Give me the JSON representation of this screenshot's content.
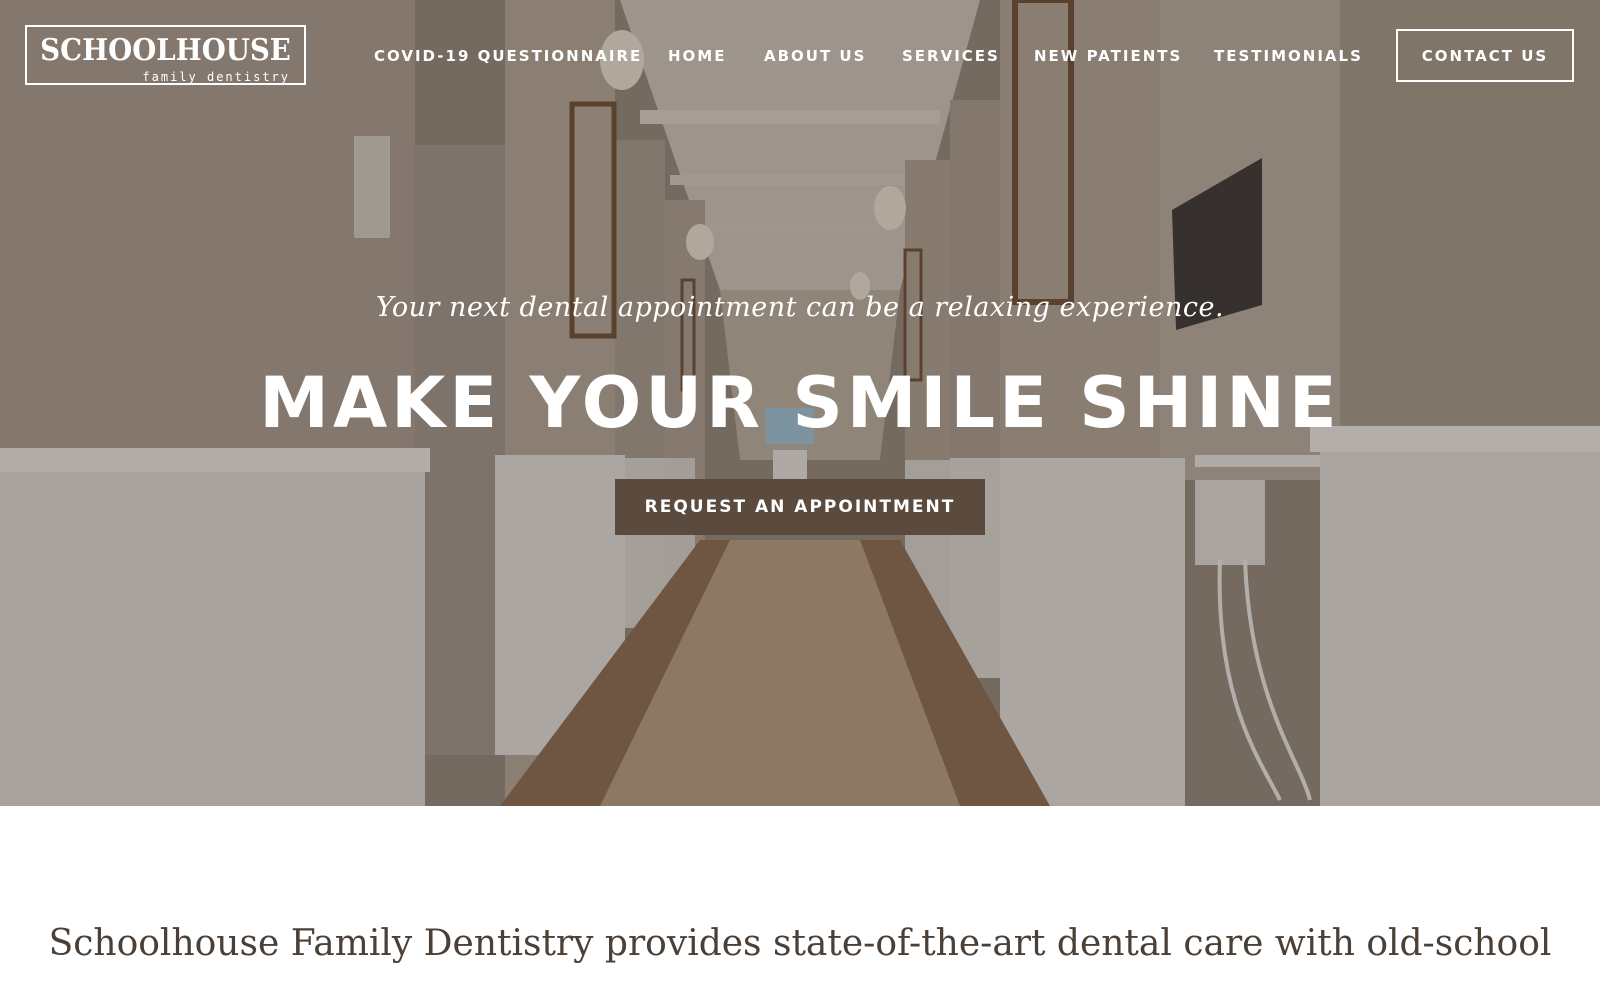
{
  "brand": {
    "name": "SCHOOLHOUSE",
    "subtitle": "family dentistry"
  },
  "nav": {
    "items": [
      {
        "label": "COVID-19 QUESTIONNAIRE"
      },
      {
        "label": "HOME"
      },
      {
        "label": "ABOUT US"
      },
      {
        "label": "SERVICES"
      },
      {
        "label": "NEW PATIENTS"
      },
      {
        "label": "TESTIMONIALS"
      }
    ],
    "contact_label": "CONTACT US"
  },
  "hero": {
    "tagline": "Your next dental appointment can be a relaxing experience.",
    "headline": "MAKE YOUR SMILE SHINE",
    "cta_label": "REQUEST AN APPOINTMENT"
  },
  "intro": {
    "text": "Schoolhouse Family Dentistry provides state-of-the-art dental care with old-school"
  },
  "colors": {
    "cta_background": "#5b4b3f",
    "intro_text": "#4a4038",
    "nav_text": "#ffffff"
  }
}
